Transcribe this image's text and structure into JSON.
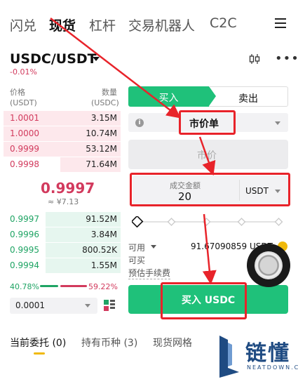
{
  "nav": {
    "tabs": [
      {
        "label": "闪兑",
        "active": false
      },
      {
        "label": "现货",
        "active": true
      },
      {
        "label": "杠杆",
        "active": false
      },
      {
        "label": "交易机器人",
        "active": false
      },
      {
        "label": "C2C",
        "active": false
      }
    ],
    "menu_icon": "menu-icon"
  },
  "pair": {
    "symbol": "USDC/USDT",
    "change": "-0.01%",
    "chart_icon": "candlestick-icon",
    "more_icon": "more-icon"
  },
  "orderbook": {
    "price_header": "价格",
    "price_unit": "(USDT)",
    "qty_header": "数量",
    "qty_unit": "(USDC)",
    "asks": [
      {
        "price": "1.0001",
        "qty": "3.15M",
        "depth": 0.97
      },
      {
        "price": "1.0000",
        "qty": "10.74M",
        "depth": 0.97
      },
      {
        "price": "0.9999",
        "qty": "53.12M",
        "depth": 0.97
      },
      {
        "price": "0.9998",
        "qty": "71.64M",
        "depth": 0.5
      }
    ],
    "last_price": "0.9997",
    "last_price_fiat": "≈ ¥7.13",
    "bids": [
      {
        "price": "0.9997",
        "qty": "91.52M",
        "depth": 0.62
      },
      {
        "price": "0.9996",
        "qty": "3.84M",
        "depth": 0.62
      },
      {
        "price": "0.9995",
        "qty": "800.52K",
        "depth": 0.62
      },
      {
        "price": "0.9994",
        "qty": "1.55M",
        "depth": 0.62
      }
    ],
    "buy_ratio": "40.78%",
    "sell_ratio": "59.22%",
    "depth_value": "0.0001",
    "layout_icon": "orderbook-layout-icon"
  },
  "form": {
    "buy_tab": "买入",
    "sell_tab": "卖出",
    "order_type": "市价单",
    "info_icon": "info-icon",
    "market_price_label": "市价",
    "amount_label": "成交金额",
    "amount_value": "20",
    "amount_unit": "USDT",
    "slider_icon": "slider-diamond-icon",
    "available_label": "可用",
    "available_value": "91.67090859 USDT",
    "can_buy_label": "可买",
    "fee_label": "预估手续费",
    "buy_button": "买入 USDC"
  },
  "bottom_tabs": [
    {
      "label": "当前委托 (0)",
      "active": true
    },
    {
      "label": "持有币种 (3)",
      "active": false
    },
    {
      "label": "现货网格",
      "active": false
    }
  ],
  "watermark": {
    "text": "链懂",
    "sub": "NEATDOWN.COM"
  },
  "colors": {
    "green": "#1fc17a",
    "red": "#d23a5d",
    "annotation_red": "#e8232a",
    "gold": "#f0b90b"
  }
}
